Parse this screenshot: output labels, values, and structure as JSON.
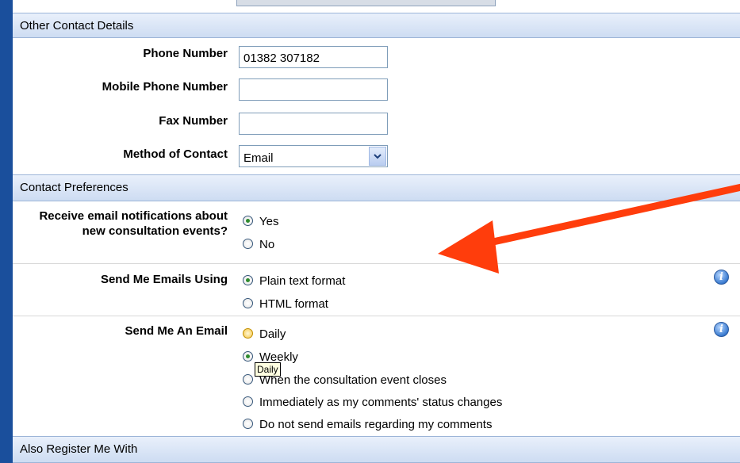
{
  "sections": {
    "other_contact": "Other Contact Details",
    "contact_prefs": "Contact Preferences",
    "also_register": "Also Register Me With"
  },
  "fields": {
    "phone": {
      "label": "Phone Number",
      "value": "01382 307182"
    },
    "mobile": {
      "label": "Mobile Phone Number",
      "value": ""
    },
    "fax": {
      "label": "Fax Number",
      "value": ""
    },
    "method": {
      "label": "Method of Contact",
      "value": "Email"
    }
  },
  "notifications": {
    "label": "Receive email notifications about new consultation events?",
    "options": [
      {
        "label": "Yes",
        "selected": true
      },
      {
        "label": "No",
        "selected": false
      }
    ]
  },
  "format": {
    "label": "Send Me Emails Using",
    "options": [
      {
        "label": "Plain text format",
        "selected": true
      },
      {
        "label": "HTML format",
        "selected": false
      }
    ],
    "info_icon": "info-icon"
  },
  "frequency": {
    "label": "Send Me An Email",
    "options": [
      {
        "label": "Daily",
        "selected": false,
        "hover": true
      },
      {
        "label": "Weekly",
        "selected": true
      },
      {
        "label": "When the consultation event closes",
        "selected": false
      },
      {
        "label": "Immediately as my comments' status changes",
        "selected": false
      },
      {
        "label": "Do not send emails regarding my comments",
        "selected": false
      }
    ],
    "info_icon": "info-icon"
  },
  "tooltip": "Daily",
  "colors": {
    "background": "#1a4f9c",
    "section_header": "#cddcf2",
    "arrow": "#ff3d0c",
    "selected_radio": "#2f8b2f"
  }
}
